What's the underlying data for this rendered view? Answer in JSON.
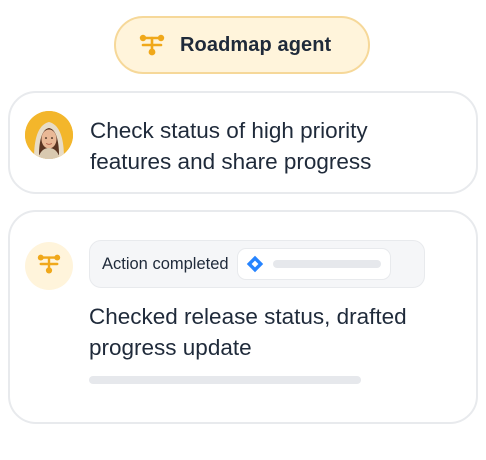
{
  "header": {
    "title": "Roadmap agent",
    "icon": "workflow-branch-icon",
    "accent_color": "#f0a81a",
    "pill_background": "#fff4db",
    "pill_border": "#f6d899"
  },
  "user_message": {
    "avatar": "user-avatar",
    "text": "Check status of high priority features and share progress"
  },
  "agent_response": {
    "avatar_icon": "workflow-branch-icon",
    "action": {
      "label": "Action completed",
      "tool_icon": "jira-icon",
      "tool_color": "#2684ff"
    },
    "text": "Checked release status, drafted progress update"
  }
}
